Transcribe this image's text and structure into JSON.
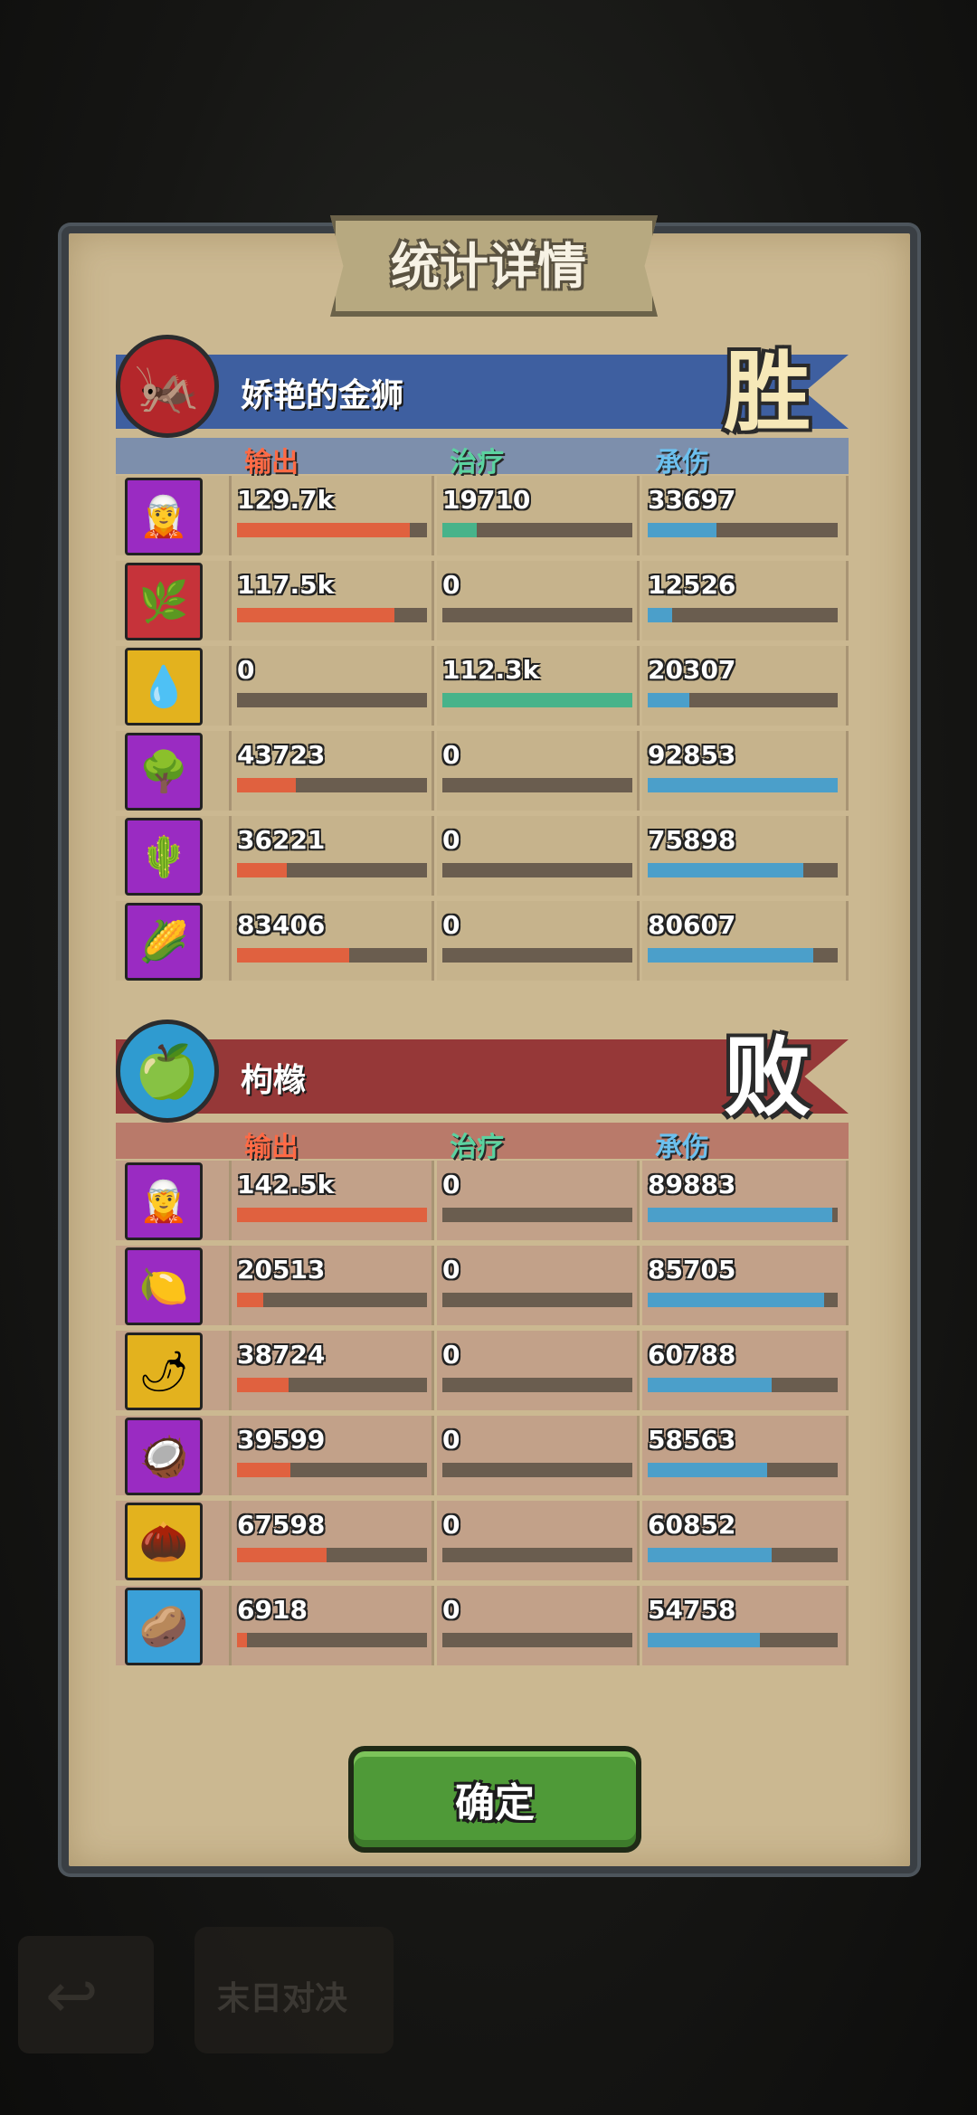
{
  "dialog": {
    "title": "统计详情",
    "confirm_label": "确定"
  },
  "background": {
    "bottom_button_label": "末日对决"
  },
  "columns": {
    "output": "输出",
    "heal": "治疗",
    "tank": "承伤"
  },
  "colors": {
    "output": "#e0613f",
    "heal": "#47b38a",
    "tank": "#4b9fca",
    "output_label": "#ff6a45",
    "heal_label": "#5bd2a0",
    "tank_label": "#6cc0ee"
  },
  "teams": [
    {
      "name": "娇艳的金狮",
      "result": "胜",
      "banner_color": "#3e5fa0",
      "header_color": "#7d8fac",
      "row_color": "#c6b38c",
      "avatar_icon": "🦗",
      "avatar_bg": "#b4272b",
      "members": [
        {
          "icon": "🧝",
          "bg": "#9a2bc2",
          "output": "129.7k",
          "heal": "19710",
          "tank": "33697",
          "output_pct": 0.91,
          "heal_pct": 0.18,
          "tank_pct": 0.36
        },
        {
          "icon": "🌿",
          "bg": "#c6333a",
          "output": "117.5k",
          "heal": "0",
          "tank": "12526",
          "output_pct": 0.83,
          "heal_pct": 0.0,
          "tank_pct": 0.13
        },
        {
          "icon": "💧",
          "bg": "#e3b21e",
          "output": "0",
          "heal": "112.3k",
          "tank": "20307",
          "output_pct": 0.0,
          "heal_pct": 1.0,
          "tank_pct": 0.22
        },
        {
          "icon": "🌳",
          "bg": "#9a2bc2",
          "output": "43723",
          "heal": "0",
          "tank": "92853",
          "output_pct": 0.31,
          "heal_pct": 0.0,
          "tank_pct": 1.0
        },
        {
          "icon": "🌵",
          "bg": "#9a2bc2",
          "output": "36221",
          "heal": "0",
          "tank": "75898",
          "output_pct": 0.26,
          "heal_pct": 0.0,
          "tank_pct": 0.82
        },
        {
          "icon": "🌽",
          "bg": "#9a2bc2",
          "output": "83406",
          "heal": "0",
          "tank": "80607",
          "output_pct": 0.59,
          "heal_pct": 0.0,
          "tank_pct": 0.87
        }
      ]
    },
    {
      "name": "枸橼",
      "result": "败",
      "banner_color": "#963838",
      "header_color": "#b97a6a",
      "row_color": "#c2a189",
      "avatar_icon": "🍏",
      "avatar_bg": "#2f9bd0",
      "members": [
        {
          "icon": "🧝",
          "bg": "#9a2bc2",
          "output": "142.5k",
          "heal": "0",
          "tank": "89883",
          "output_pct": 1.0,
          "heal_pct": 0.0,
          "tank_pct": 0.97
        },
        {
          "icon": "🍋",
          "bg": "#9a2bc2",
          "output": "20513",
          "heal": "0",
          "tank": "85705",
          "output_pct": 0.14,
          "heal_pct": 0.0,
          "tank_pct": 0.93
        },
        {
          "icon": "🌶",
          "bg": "#e3b21e",
          "output": "38724",
          "heal": "0",
          "tank": "60788",
          "output_pct": 0.27,
          "heal_pct": 0.0,
          "tank_pct": 0.65
        },
        {
          "icon": "🥥",
          "bg": "#9a2bc2",
          "output": "39599",
          "heal": "0",
          "tank": "58563",
          "output_pct": 0.28,
          "heal_pct": 0.0,
          "tank_pct": 0.63
        },
        {
          "icon": "🌰",
          "bg": "#e3b21e",
          "output": "67598",
          "heal": "0",
          "tank": "60852",
          "output_pct": 0.47,
          "heal_pct": 0.0,
          "tank_pct": 0.65
        },
        {
          "icon": "🥔",
          "bg": "#3aa0d8",
          "output": "6918",
          "heal": "0",
          "tank": "54758",
          "output_pct": 0.05,
          "heal_pct": 0.0,
          "tank_pct": 0.59
        }
      ]
    }
  ]
}
